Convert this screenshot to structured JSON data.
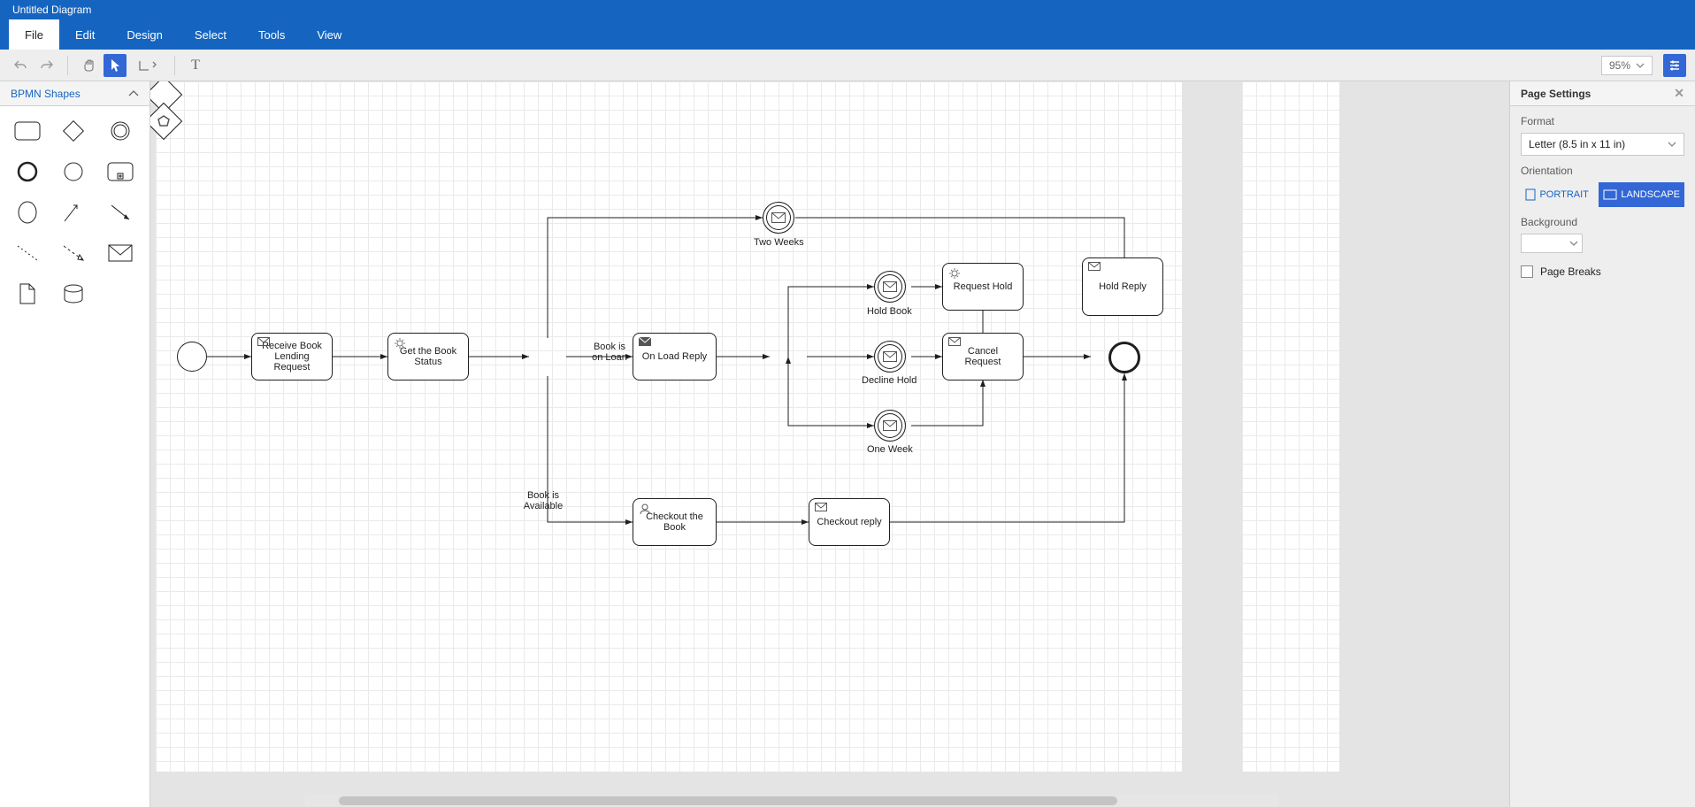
{
  "title": "Untitled Diagram",
  "menu": {
    "file": "File",
    "edit": "Edit",
    "design": "Design",
    "select": "Select",
    "tools": "Tools",
    "view": "View"
  },
  "toolbar": {
    "zoom": "95%"
  },
  "shapes_panel": {
    "title": "BPMN Shapes"
  },
  "nodes": {
    "receive": "Receive Book Lending Request",
    "get_status": "Get the Book Status",
    "on_load_reply": "On Load Reply",
    "request_hold": "Request Hold",
    "hold_reply": "Hold Reply",
    "cancel_request": "Cancel Request",
    "checkout_book": "Checkout the Book",
    "checkout_reply": "Checkout reply"
  },
  "labels": {
    "two_weeks": "Two Weeks",
    "hold_book": "Hold Book",
    "decline_hold": "Decline Hold",
    "one_week": "One Week",
    "on_loan1": "Book is",
    "on_loan2": "on Loan",
    "available1": "Book is",
    "available2": "Available"
  },
  "right": {
    "title": "Page Settings",
    "format": "Format",
    "format_value": "Letter (8.5 in x 11 in)",
    "orientation": "Orientation",
    "portrait": "PORTRAIT",
    "landscape": "LANDSCAPE",
    "background": "Background",
    "page_breaks": "Page Breaks"
  }
}
